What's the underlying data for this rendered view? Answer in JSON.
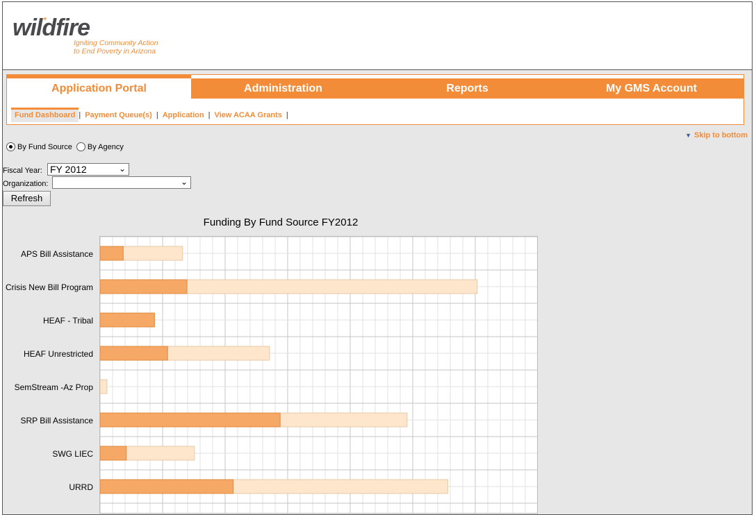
{
  "logo": {
    "word": "wildfire",
    "tagline_1": "Igniting Community Action",
    "tagline_2": "to End Poverty in Arizona"
  },
  "tabs": [
    {
      "label": "Application Portal",
      "active": true
    },
    {
      "label": "Administration"
    },
    {
      "label": "Reports"
    },
    {
      "label": "My GMS Account"
    }
  ],
  "subnav": [
    {
      "label": "Fund Dashboard",
      "active": true
    },
    {
      "label": "Payment Queue(s)"
    },
    {
      "label": "Application"
    },
    {
      "label": "View ACAA Grants"
    }
  ],
  "subnav_sep": "|",
  "skip": "Skip to bottom",
  "skip_icon": "triangle-down",
  "view_options": {
    "fund_source": "By Fund Source",
    "agency": "By Agency",
    "selected": "By Fund Source"
  },
  "filters": {
    "fiscal_year_label": "Fiscal Year:",
    "fiscal_year": "FY 2012",
    "organization_label": "Organization:",
    "organization": ""
  },
  "refresh_label": "Refresh",
  "colors": {
    "accent": "#f28c38",
    "bar_spent": "#f6a866",
    "bar_total": "#fde6cc"
  },
  "chart_data": {
    "type": "bar",
    "orientation": "horizontal",
    "stacked": true,
    "title": "Funding By Fund Source FY2012",
    "categories": [
      "APS Bill Assistance",
      "Crisis New Bill Program",
      "HEAF - Tribal",
      "HEAF Unrestricted",
      "SemStream -Az Prop",
      "SRP Bill Assistance",
      "SWG LIEC",
      "URRD"
    ],
    "series": [
      {
        "values": [
          0.37,
          1.39,
          0.87,
          1.08,
          0,
          2.88,
          0.42,
          2.13
        ]
      },
      {
        "values": [
          0.95,
          4.64,
          0,
          1.63,
          0.11,
          2.03,
          1.09,
          3.43
        ]
      }
    ],
    "xlim": [
      0,
      7
    ],
    "grid": true
  }
}
